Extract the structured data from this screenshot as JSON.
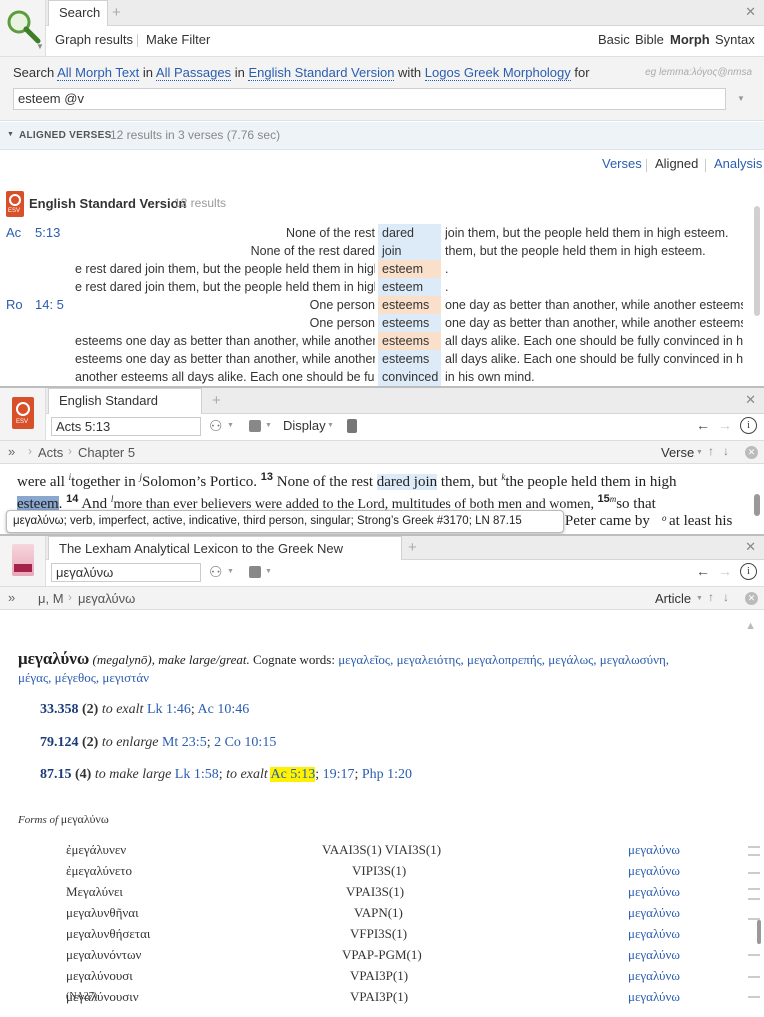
{
  "search": {
    "tab_label": "Search",
    "graph_results": "Graph results",
    "make_filter": "Make Filter",
    "modes": [
      "Basic",
      "Bible",
      "Morph",
      "Syntax"
    ],
    "active_mode": "Morph",
    "line": {
      "w1": "Search",
      "l1": "All Morph Text",
      "w2": "in",
      "l2": "All Passages",
      "w3": "in",
      "l3": "English Standard Version",
      "w4": "with",
      "l4": "Logos Greek Morphology",
      "w5": "for"
    },
    "example": "eg lemma:λόγος@nmsa",
    "query": "esteem @v"
  },
  "aligned": {
    "header": "ALIGNED VERSES",
    "summary": "12 results in 3 verses (7.76 sec)",
    "views": [
      "Verses",
      "Aligned",
      "Analysis"
    ],
    "version": "English Standard Version",
    "count": "12 results",
    "badge": "ESV",
    "refs": [
      {
        "book": "Ac",
        "ref": "5:13"
      },
      {
        "book": "Ro",
        "ref": "14: 5"
      }
    ],
    "rows": [
      {
        "left": "None of the rest",
        "kw": "dared",
        "right": "join them, but the people held them in high esteem.",
        "hl": false
      },
      {
        "left": "None of the rest dared",
        "kw": "join",
        "right": "them, but the people held them in high esteem.",
        "hl": false
      },
      {
        "left": "e rest dared join them, but the people held them in high",
        "kw": "esteem",
        "right": ".",
        "hl": true
      },
      {
        "left": "e rest dared join them, but the people held them in high",
        "kw": "esteem",
        "right": ".",
        "hl": false
      },
      {
        "left": "One person",
        "kw": "esteems",
        "right": "one day as better than another, while another esteems",
        "hl": true
      },
      {
        "left": "One person",
        "kw": "esteems",
        "right": "one day as better than another, while another esteems",
        "hl": false
      },
      {
        "left": "esteems one day as better than another, while another",
        "kw": "esteems",
        "right": "all days alike. Each one should be fully convinced in his o",
        "hl": true
      },
      {
        "left": "esteems one day as better than another, while another",
        "kw": "esteems",
        "right": "all days alike. Each one should be fully convinced in his o",
        "hl": false
      },
      {
        "left": "another esteems all days alike. Each one should be fully",
        "kw": "convinced",
        "right": "in his own mind.",
        "hl": false
      }
    ]
  },
  "bible": {
    "tab_label": "English Standard Version",
    "badge": "ESV",
    "reference": "Acts 5:13",
    "display": "Display",
    "breadcrumb": [
      "Acts",
      "Chapter 5"
    ],
    "verse_label": "Verse",
    "text": {
      "p1": "were all ",
      "fn1": "i",
      "p2": "together in ",
      "fn2": "j",
      "p3": "Solomon’s Portico. ",
      "v13": "13",
      "p4": " None of the rest ",
      "w_dared": "dared",
      "sp": " ",
      "w_join": "join",
      "p5": " them, but ",
      "fn3": "k",
      "p6": "the people held them in high",
      "w_esteem": "esteem",
      "p7": ". ",
      "v14": "14",
      "p8": " And ",
      "fn4": "l",
      "p9": "more than ever believers were added to the Lord, multitudes of both men and women, ",
      "v15": "15",
      "fn5": "m",
      "p10": "so that"
    },
    "line3_tail": ": Peter came by ",
    "fn6": "o",
    "line3_end": "at least his",
    "tooltip": "μεγαλύνω; verb, imperfect, active, indicative, third person, singular; Strong’s Greek #3170; LN 87.15"
  },
  "lexicon": {
    "tab_label": "The Lexham Analytical Lexicon to the Greek New Testament",
    "reference": "μεγαλύνω",
    "breadcrumb": [
      "μ, Μ",
      "μεγαλύνω"
    ],
    "article_label": "Article",
    "headword": "μεγαλύνω",
    "translit": "(megalynō),",
    "gloss": "make large/great.",
    "cognate_label": "Cognate words:",
    "cognates_line1": "μεγαλεῖος, μεγαλειότης, μεγαλοπρεπής, μεγάλως, μεγαλωσύνη,",
    "cognates_line2": "μέγας, μέγεθος, μεγιστάν",
    "senses": [
      {
        "code": "33.358",
        "count": "(2)",
        "def": "to exalt",
        "refs": [
          "Lk 1:46",
          "Ac 10:46"
        ]
      },
      {
        "code": "79.124",
        "count": "(2)",
        "def": "to enlarge",
        "refs": [
          "Mt 23:5",
          "2 Co 10:15"
        ]
      },
      {
        "code": "87.15",
        "count": "(4)",
        "def": "to make large",
        "refs": [
          "Lk 1:58"
        ],
        "def2": "to exalt",
        "hl_ref": "Ac 5:13",
        "refs2": [
          "19:17",
          "Php 1:20"
        ]
      }
    ],
    "forms_label": "Forms of",
    "forms_lemma": "μεγαλύνω",
    "forms": [
      {
        "form": "ἐμεγάλυνεν",
        "parse": "VAAI3S(1) VIAI3S(1)",
        "lemma": "μεγαλύνω"
      },
      {
        "form": "ἐμεγαλύνετο",
        "parse": "VIPI3S(1)",
        "lemma": "μεγαλύνω"
      },
      {
        "form": "Μεγαλύνει",
        "parse": "VPAI3S(1)",
        "lemma": "μεγαλύνω"
      },
      {
        "form": "μεγαλυνθῆναι",
        "parse": "VAPN(1)",
        "lemma": "μεγαλύνω"
      },
      {
        "form": "μεγαλυνθήσεται",
        "parse": "VFPI3S(1)",
        "lemma": "μεγαλύνω"
      },
      {
        "form": "μεγαλυνόντων",
        "parse": "VPAP-PGM(1)",
        "lemma": "μεγαλύνω"
      },
      {
        "form": "μεγαλύνουσι",
        "parse": "VPAI3P(1)",
        "lemma": "μεγαλύνω"
      },
      {
        "form": "μεγαλύνουσιν",
        "form_note": "(NA27)",
        "parse": "VPAI3P(1)",
        "lemma": "μεγαλύνω"
      }
    ]
  },
  "icons": {
    "search": "magnifier-icon",
    "close": "close-icon",
    "plus": "plus-icon"
  },
  "colors": {
    "link": "#2a5db0",
    "keyword_bg": "#ddeaf7",
    "keyword_hl": "#fae0cb",
    "esv_badge": "#d8502a",
    "selection": "#8aa7cf",
    "highlight_yellow": "#fff200"
  }
}
